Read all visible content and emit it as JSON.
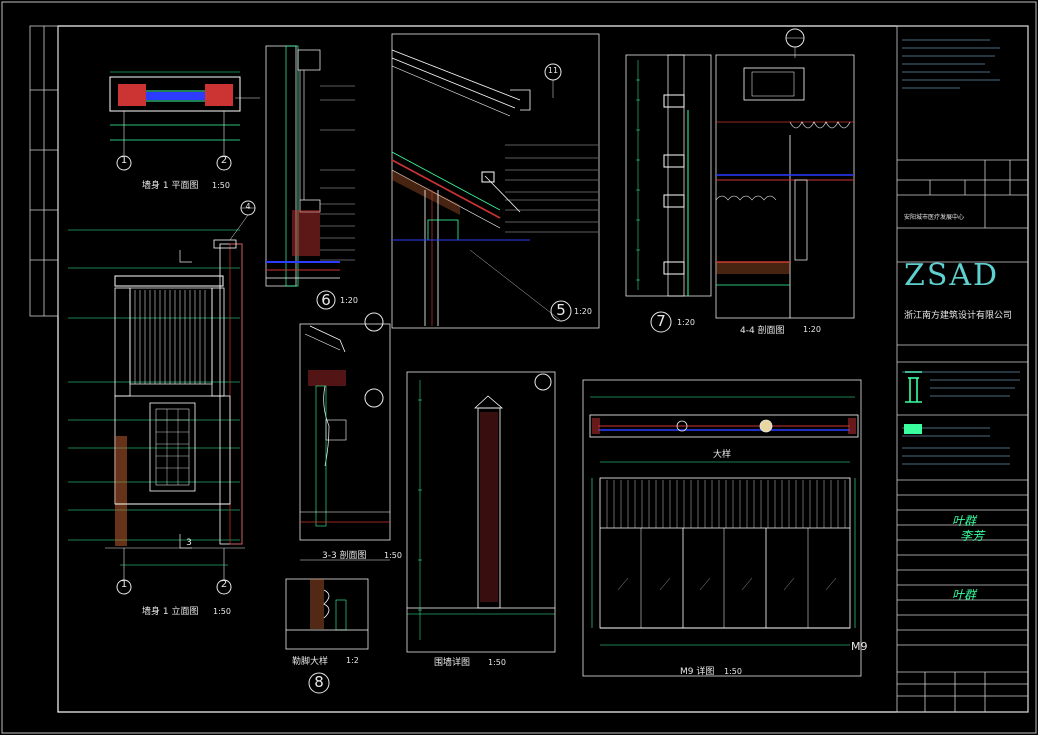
{
  "drawings": {
    "d1_plan_title": "墙身 1 平面图",
    "d1_plan_scale": "1:50",
    "d1_elev_title": "墙身 1 立面图",
    "d1_elev_scale": "1:50",
    "d6_scale": "1:20",
    "d5_scale": "1:20",
    "d7_scale": "1:20",
    "s44_title": "4-4 剖面图",
    "s44_scale": "1:20",
    "s33_title": "3-3 剖面图",
    "s33_scale": "1:50",
    "d8_title": "勒脚大样",
    "d8_scale": "1:2",
    "wall_title": "围墙详图",
    "wall_scale": "1:50",
    "m9_title": "M9 详图",
    "m9_scale": "1:50",
    "m9_section_label": "大样",
    "m9_tag": "M9"
  },
  "bubbles": {
    "b1": "1",
    "b2": "2",
    "b3": "3",
    "b4": "4",
    "b5": "5",
    "b6": "6",
    "b7": "7",
    "b8": "8",
    "b11": "11"
  },
  "title_block": {
    "logo": "ZSAD",
    "company": "浙江南方建筑设计有限公司",
    "project": "安阳城市医疗发展中心",
    "designer_sign_1": "叶群",
    "designer_sign_2": "李芳",
    "designer_sign_3": "叶群"
  }
}
